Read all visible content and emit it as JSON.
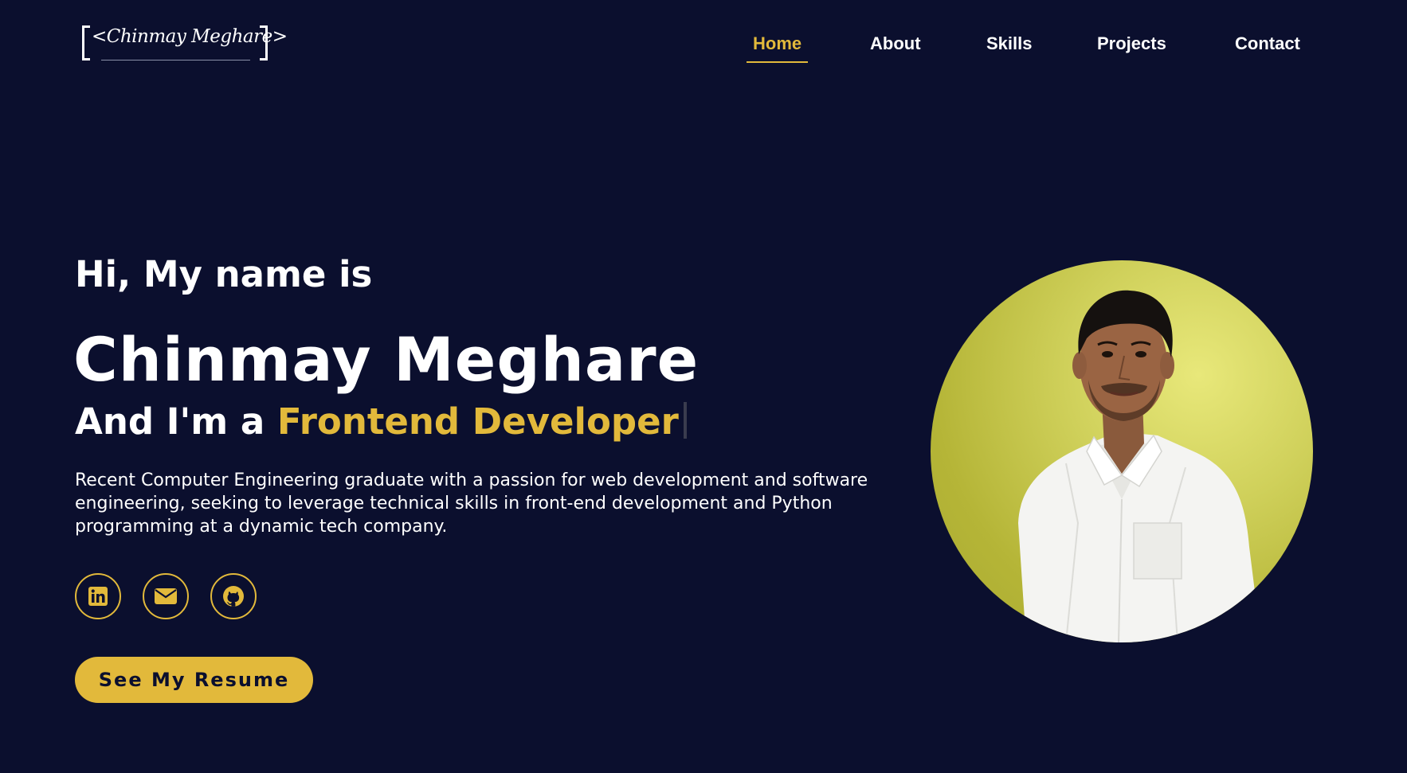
{
  "header": {
    "logo_text": "<Chinmay Meghare>",
    "nav": [
      {
        "label": "Home",
        "active": true
      },
      {
        "label": "About",
        "active": false
      },
      {
        "label": "Skills",
        "active": false
      },
      {
        "label": "Projects",
        "active": false
      },
      {
        "label": "Contact",
        "active": false
      }
    ]
  },
  "hero": {
    "greeting": "Hi, My name is",
    "name": "Chinmay Meghare",
    "role_prefix": "And I'm a ",
    "role": "Frontend Developer",
    "description": "Recent Computer Engineering graduate with a passion for web development and software engineering, seeking to leverage technical skills in front-end development and Python programming at a dynamic tech company.",
    "socials": [
      {
        "icon": "linkedin-icon"
      },
      {
        "icon": "email-icon"
      },
      {
        "icon": "github-icon"
      }
    ],
    "resume_button": "See My Resume"
  },
  "colors": {
    "background": "#0b0f2e",
    "accent": "#e2b93b",
    "text": "#ffffff"
  }
}
